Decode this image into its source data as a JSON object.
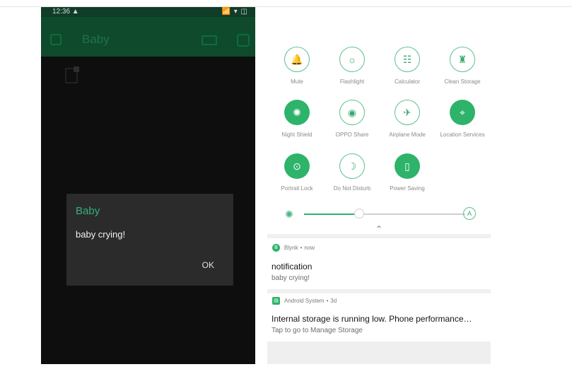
{
  "status_bar": {
    "time": "12:36 ▲",
    "icons": "📶 ▾ ◫"
  },
  "app": {
    "title": "Baby"
  },
  "dialog": {
    "title": "Baby",
    "message": "baby crying!",
    "ok_label": "OK"
  },
  "quick_settings": {
    "tiles": [
      {
        "label": "Mute",
        "icon": "bell-icon",
        "glyph": "🔔",
        "active": false
      },
      {
        "label": "Flashlight",
        "icon": "flashlight-icon",
        "glyph": "☼",
        "active": false
      },
      {
        "label": "Calculator",
        "icon": "calculator-icon",
        "glyph": "☷",
        "active": false
      },
      {
        "label": "Clean Storage",
        "icon": "broom-icon",
        "glyph": "♜",
        "active": false
      },
      {
        "label": "Night Shield",
        "icon": "sun-icon",
        "glyph": "✺",
        "active": true
      },
      {
        "label": "OPPO Share",
        "icon": "share-icon",
        "glyph": "◉",
        "active": false
      },
      {
        "label": "Airplane Mode",
        "icon": "airplane-icon",
        "glyph": "✈",
        "active": false
      },
      {
        "label": "Location Services",
        "icon": "location-icon",
        "glyph": "⌖",
        "active": true
      },
      {
        "label": "Portrait Lock",
        "icon": "lock-icon",
        "glyph": "⊙",
        "active": true
      },
      {
        "label": "Do Not Disturb",
        "icon": "moon-icon",
        "glyph": "☽",
        "active": false
      },
      {
        "label": "Power Saving",
        "icon": "battery-icon",
        "glyph": "▯",
        "active": true
      }
    ],
    "brightness_level": 0.34,
    "auto_label": "A",
    "collapse_glyph": "⌃"
  },
  "notifications": [
    {
      "app_name": "Blynk",
      "time": "now",
      "title": "notification",
      "body": "baby crying!",
      "app_glyph": "B"
    },
    {
      "app_name": "Android System",
      "time": "3d",
      "title": "Internal storage is running low. Phone performance…",
      "body": "Tap to go to Manage Storage",
      "app_glyph": "▤"
    }
  ],
  "colors": {
    "accent": "#2db36a",
    "appbar": "#0f4a2d",
    "dialog_bg": "#2b2b2b"
  }
}
